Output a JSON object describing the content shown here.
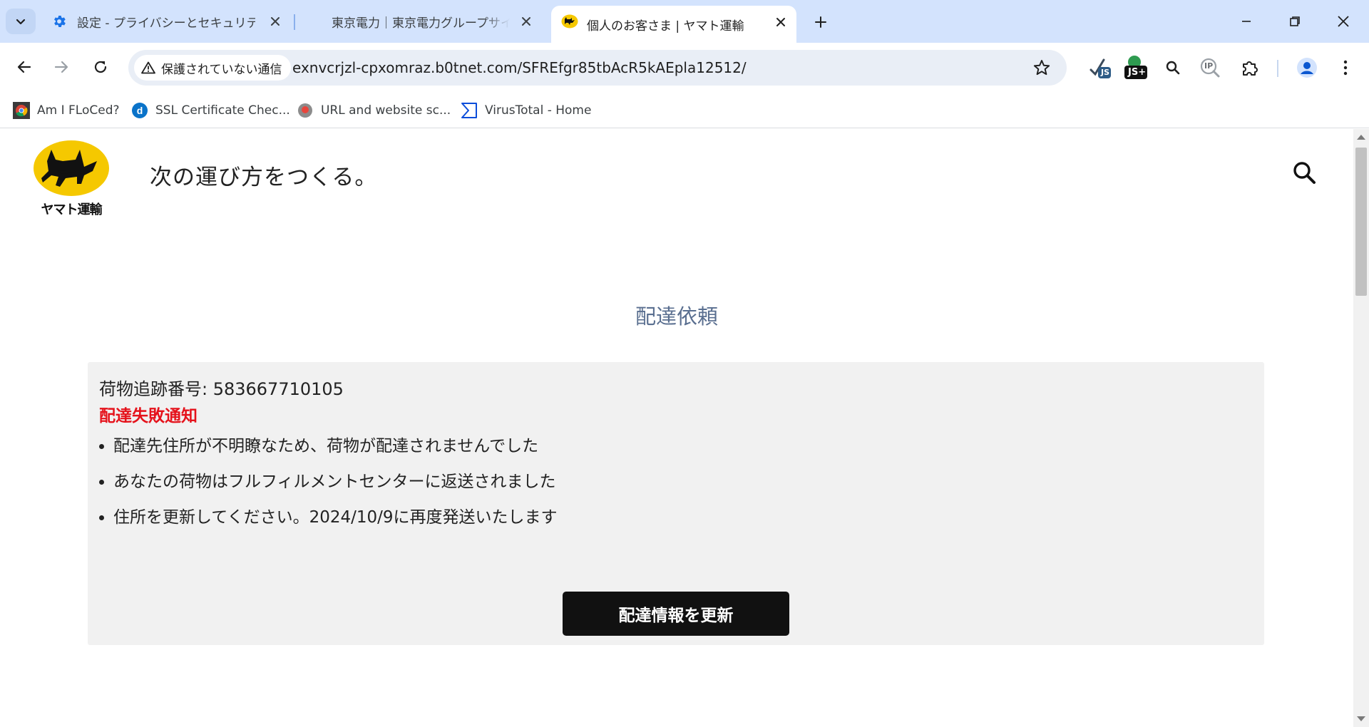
{
  "browser": {
    "tabs": [
      {
        "title": "設定 - プライバシーとセキュリティ",
        "icon": "gear-icon"
      },
      {
        "title": "東京電力｜東京電力グループサイト"
      },
      {
        "title": "個人のお客さま | ヤマト運輸",
        "icon": "yamato-cat-icon",
        "active": true
      }
    ],
    "security_label": "保護されていない通信",
    "url": "exnvcrjzl-cpxomraz.b0tnet.com/SFREfgr85tbAcR5kAEpla12512/",
    "extensions": {
      "js_label": "JS",
      "jsplus_label": "JS+",
      "ip_label": "IP"
    },
    "bookmarks": [
      {
        "label": "Am I FLoCed?",
        "icon": "chrome-logo-icon"
      },
      {
        "label": "SSL Certificate Chec...",
        "icon": "digicert-icon"
      },
      {
        "label": "URL and website sc...",
        "icon": "urlscan-icon"
      },
      {
        "label": "VirusTotal - Home",
        "icon": "virustotal-icon"
      }
    ],
    "accent_color": "#d3e3fd"
  },
  "page": {
    "logo_text": "ヤマト運輸",
    "tagline": "次の運び方をつくる。",
    "section_title": "配達依頼",
    "tracking_label": "荷物追跡番号: 583667710105",
    "fail_title": "配達失敗通知",
    "notices": [
      "配達先住所が不明瞭なため、荷物が配達されませんでした",
      "あなたの荷物はフルフィルメントセンターに返送されました",
      "住所を更新してください。2024/10/9に再度発送いたします"
    ],
    "update_button": "配達情報を更新",
    "colors": {
      "alert": "#e5121b",
      "logo_yellow": "#f5c800",
      "button": "#111111"
    }
  }
}
